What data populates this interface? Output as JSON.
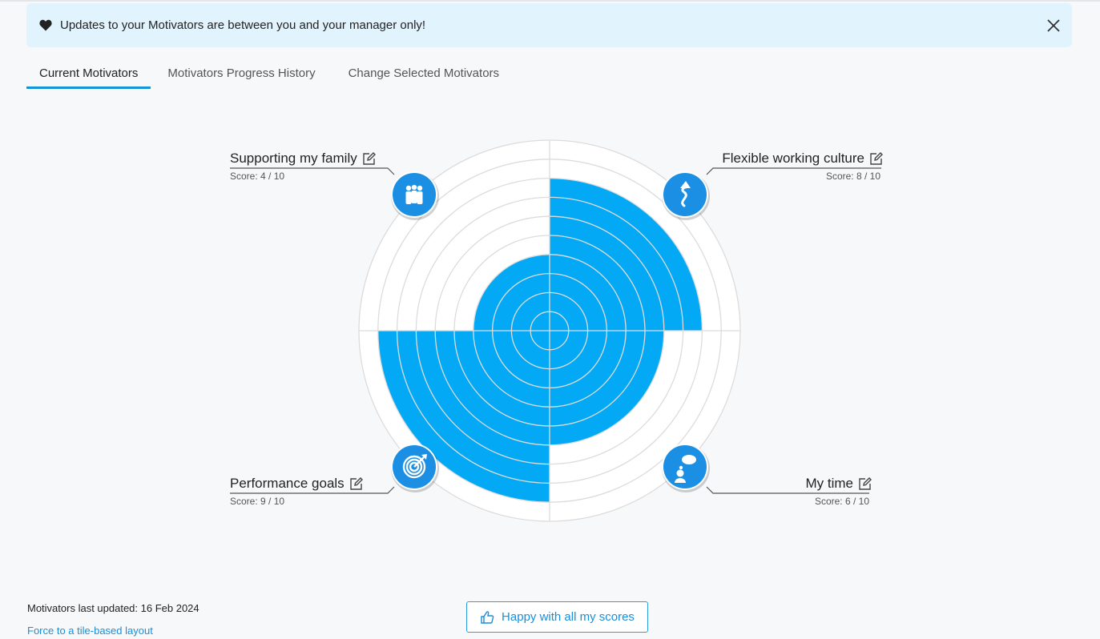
{
  "banner": {
    "message": "Updates to your Motivators are between you and your manager only!",
    "icon": "heart-icon",
    "close_icon": "close-icon"
  },
  "tabs": [
    {
      "label": "Current Motivators",
      "active": true
    },
    {
      "label": "Motivators Progress History",
      "active": false
    },
    {
      "label": "Change Selected Motivators",
      "active": false
    }
  ],
  "motivators": {
    "max_score": 10,
    "items": [
      {
        "name": "Supporting my family",
        "score_text": "Score: 4 / 10",
        "score": 4,
        "quadrant": "top-left",
        "icon": "family-icon"
      },
      {
        "name": "Flexible working culture",
        "score_text": "Score: 8 / 10",
        "score": 8,
        "quadrant": "top-right",
        "icon": "winding-arrow-icon"
      },
      {
        "name": "My time",
        "score_text": "Score: 6 / 10",
        "score": 6,
        "quadrant": "bottom-right",
        "icon": "thought-bubble-icon"
      },
      {
        "name": "Performance goals",
        "score_text": "Score: 9 / 10",
        "score": 9,
        "quadrant": "bottom-left",
        "icon": "target-icon"
      }
    ]
  },
  "footer": {
    "last_updated": "Motivators last updated: 16 Feb 2024",
    "layout_link": "Force to a tile-based layout",
    "happy_button": "Happy with all my scores"
  },
  "colors": {
    "fill": "#03a9f4",
    "icon_bg": "#1a8fe3",
    "accent": "#1296d8",
    "banner_bg": "#e1f3fc"
  }
}
